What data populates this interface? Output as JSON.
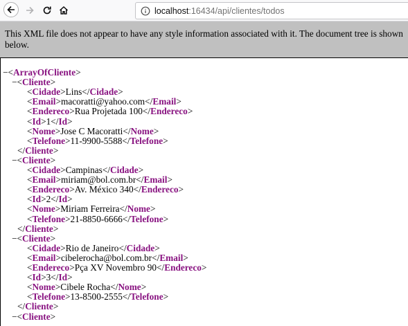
{
  "browser": {
    "url_host": "localhost",
    "url_path": ":16434/api/clientes/todos"
  },
  "banner": {
    "message": "This XML file does not appear to have any style information associated with it. The document tree is shown below."
  },
  "xml": {
    "root_tag": "ArrayOfCliente",
    "item_tag": "Cliente",
    "field_tags": [
      "Cidade",
      "Email",
      "Endereco",
      "Id",
      "Nome",
      "Telefone"
    ],
    "clientes": [
      {
        "Cidade": "Lins",
        "Email": "macoratti@yahoo.com",
        "Endereco": "Rua Projetada 100",
        "Id": "1",
        "Nome": "Jose C Macoratti",
        "Telefone": "11-9900-5588"
      },
      {
        "Cidade": "Campinas",
        "Email": "miriam@bol.com.br",
        "Endereco": "Av. México 340",
        "Id": "2",
        "Nome": "Miriam Ferreira",
        "Telefone": "21-8850-6666"
      },
      {
        "Cidade": "Rio de Janeiro",
        "Email": "cibelerocha@bol.com.br",
        "Endereco": "Pça XV Novembro 90",
        "Id": "3",
        "Nome": "Cibele Rocha",
        "Telefone": "13-8500-2555"
      }
    ],
    "collapse_symbol": "−"
  }
}
